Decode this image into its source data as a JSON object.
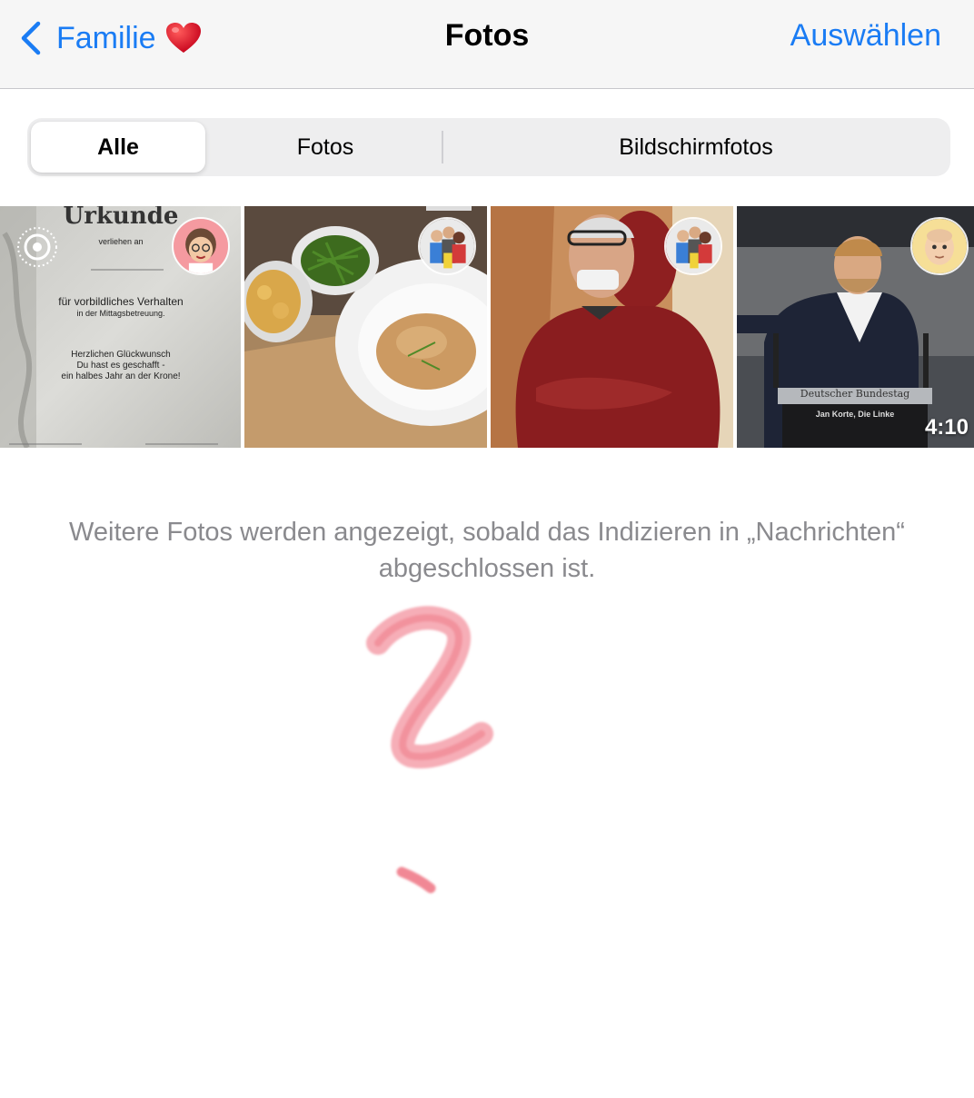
{
  "nav": {
    "back_label": "Familie",
    "back_icon": "chevron-left-icon",
    "heart_icon": "heart-icon",
    "title": "Fotos",
    "select_label": "Auswählen",
    "accent_color": "#1a7cf4"
  },
  "segments": {
    "items": [
      {
        "label": "Alle",
        "selected": true
      },
      {
        "label": "Fotos",
        "selected": false
      },
      {
        "label": "Bildschirmfotos",
        "selected": false
      }
    ]
  },
  "photos": [
    {
      "kind": "document-photo",
      "live_icon": "live-photo-icon",
      "avatar": "memoji-avatar",
      "doc": {
        "heading": "Urkunde",
        "sub": "verliehen an",
        "line1": "für vorbildliches Verhalten",
        "line2": "in der Mittagsbetreuung.",
        "line3": "Herzlichen Glückwunsch",
        "line4": "Du hast es geschafft -",
        "line5": "ein halbes Jahr an der Krone!"
      }
    },
    {
      "kind": "food-photo",
      "avatar": "group-avatar"
    },
    {
      "kind": "portrait-photo",
      "avatar": "group-avatar"
    },
    {
      "kind": "video",
      "avatar": "memoji-avatar",
      "duration": "4:10",
      "lectern_title": "Deutscher Bundestag",
      "lectern_name": "Jan Korte, Die Linke"
    }
  ],
  "info_text": "Weitere Fotos werden angezeigt, sobald das Indizieren in „Nachrichten“ abgeschlossen ist.",
  "scribble": {
    "color": "#f4a0aa",
    "icon": "handwritten-scribble"
  }
}
